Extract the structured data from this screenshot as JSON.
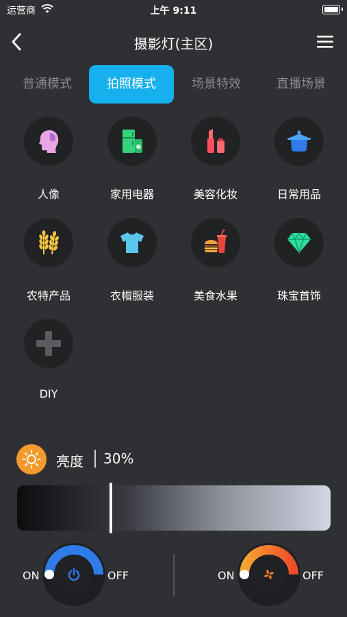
{
  "status": {
    "carrier": "运营商",
    "time": "上午 9:11"
  },
  "nav": {
    "title": "摄影灯(主区)",
    "back_icon": "chevron-left-icon",
    "menu_icon": "hamburger-menu-icon"
  },
  "tabs": [
    {
      "label": "普通模式",
      "active": false
    },
    {
      "label": "拍照模式",
      "active": true
    },
    {
      "label": "场景特效",
      "active": false
    },
    {
      "label": "直播场景",
      "active": false
    }
  ],
  "categories": [
    {
      "label": "人像",
      "icon": "portrait-icon"
    },
    {
      "label": "家用电器",
      "icon": "appliance-icon"
    },
    {
      "label": "美容化妆",
      "icon": "cosmetics-icon"
    },
    {
      "label": "日常用品",
      "icon": "pot-icon"
    },
    {
      "label": "农特产品",
      "icon": "wheat-icon"
    },
    {
      "label": "衣帽服装",
      "icon": "tshirt-icon"
    },
    {
      "label": "美食水果",
      "icon": "burger-drink-icon"
    },
    {
      "label": "珠宝首饰",
      "icon": "diamond-icon"
    },
    {
      "label": "DIY",
      "icon": "plus-icon"
    }
  ],
  "brightness": {
    "label": "亮度",
    "value_text": "30%",
    "value": 0.3
  },
  "controls": {
    "left": {
      "on": "ON",
      "off": "OFF",
      "icon": "power-icon",
      "color": "#2f7be8"
    },
    "right": {
      "on": "ON",
      "off": "OFF",
      "icon": "fan-icon",
      "color": "#f07a2c"
    }
  },
  "colors": {
    "accent": "#16b0ee",
    "background": "#2f3033",
    "sun": "#f49a2f"
  }
}
